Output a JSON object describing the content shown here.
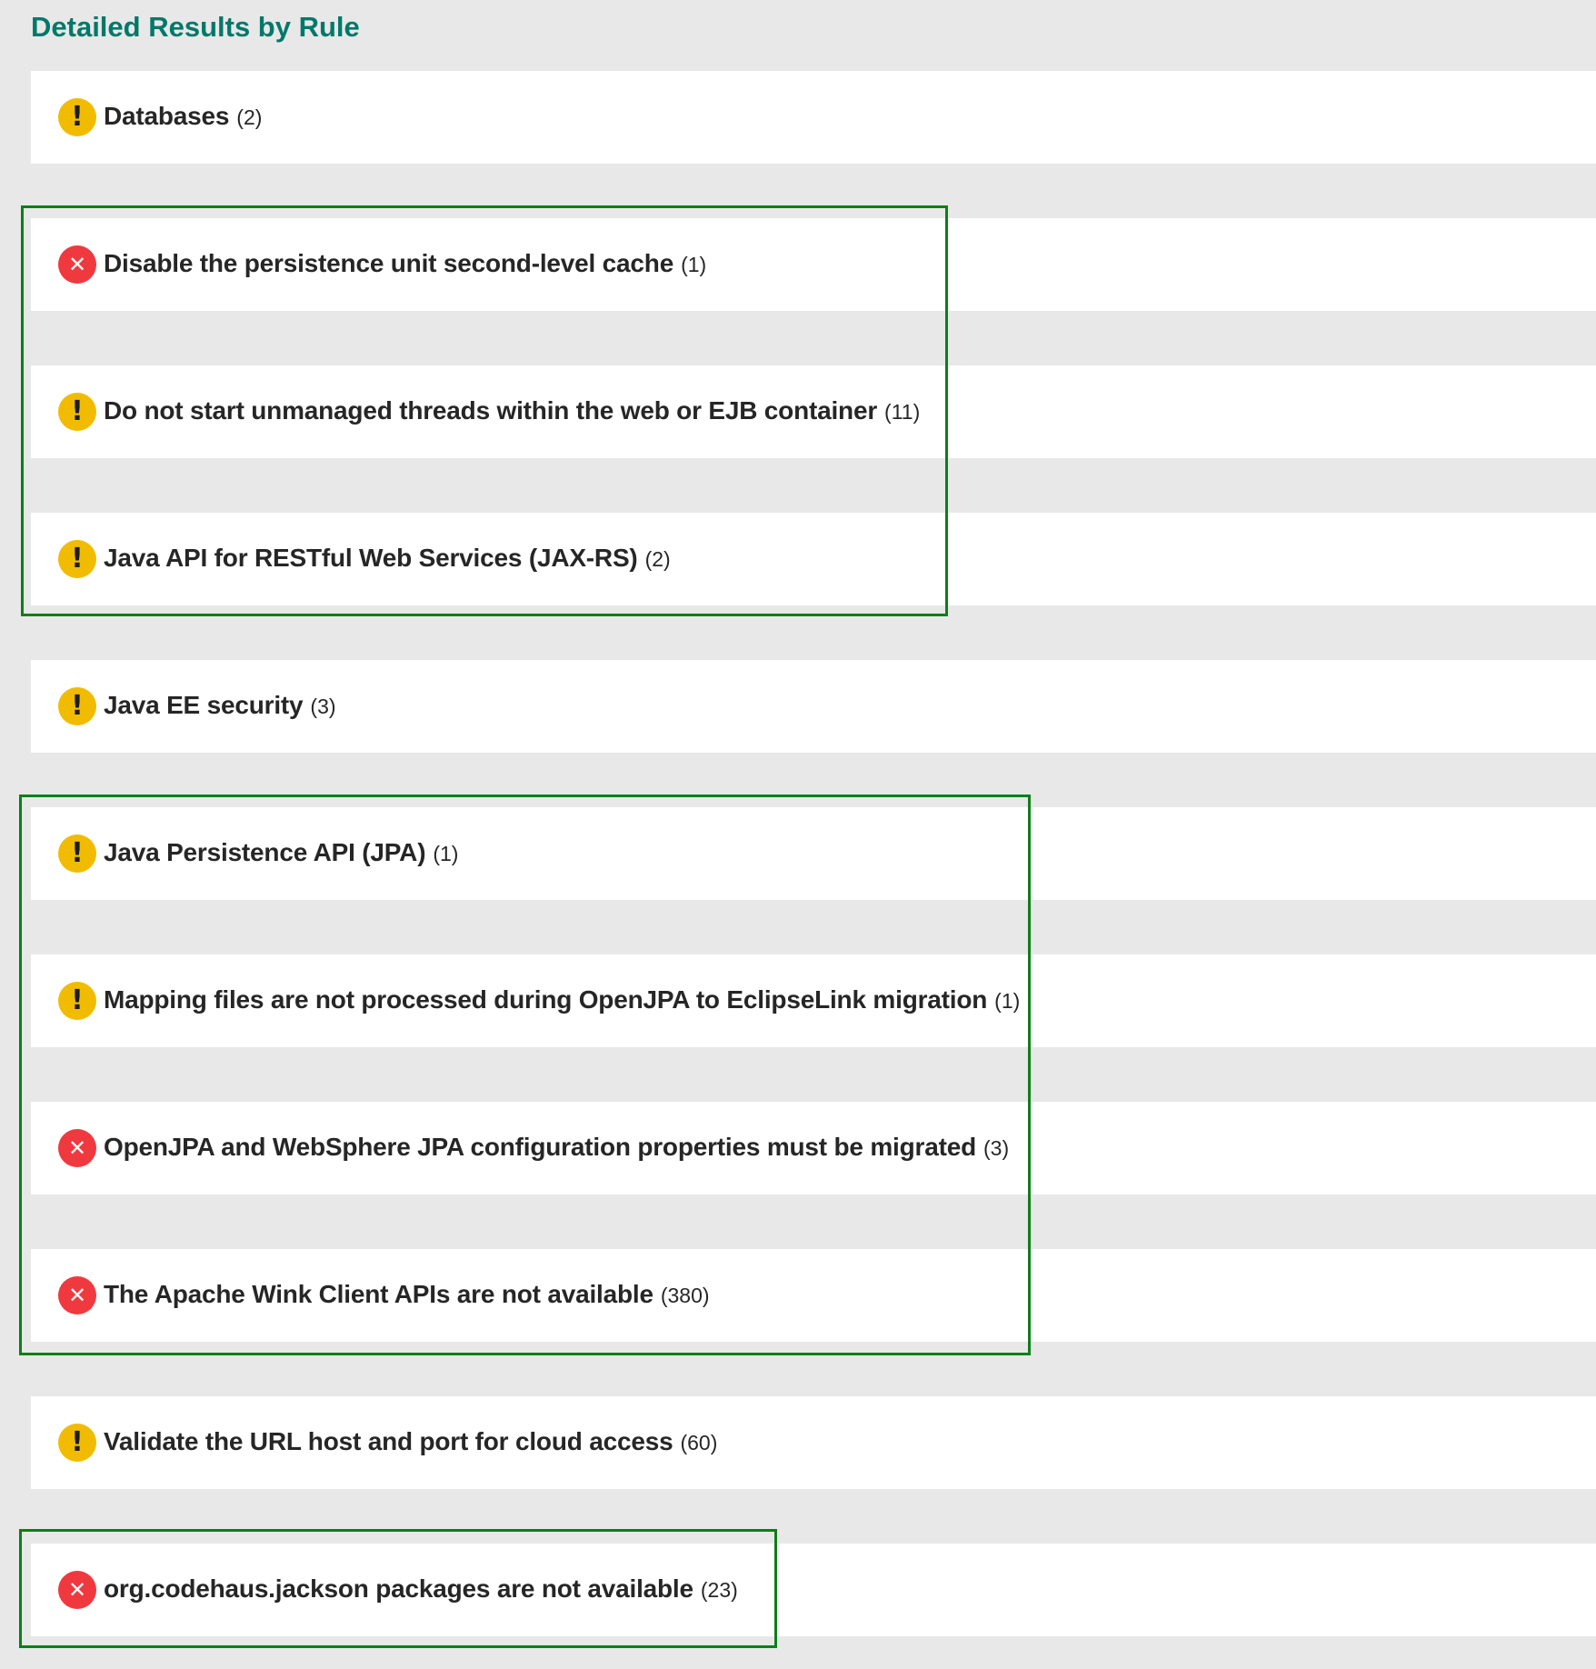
{
  "header": {
    "title": "Detailed Results by Rule"
  },
  "rules": [
    {
      "label": "Databases",
      "count": "(2)",
      "severity": "warning",
      "icon": "exclamation-icon",
      "icon_glyph": "!"
    },
    {
      "label": "Disable the persistence unit second-level cache",
      "count": "(1)",
      "severity": "error",
      "icon": "close-icon",
      "icon_glyph": "✕"
    },
    {
      "label": "Do not start unmanaged threads within the web or EJB container",
      "count": "(11)",
      "severity": "warning",
      "icon": "exclamation-icon",
      "icon_glyph": "!"
    },
    {
      "label": "Java API for RESTful Web Services (JAX-RS)",
      "count": "(2)",
      "severity": "warning",
      "icon": "exclamation-icon",
      "icon_glyph": "!"
    },
    {
      "label": "Java EE security",
      "count": "(3)",
      "severity": "warning",
      "icon": "exclamation-icon",
      "icon_glyph": "!"
    },
    {
      "label": "Java Persistence API (JPA)",
      "count": "(1)",
      "severity": "warning",
      "icon": "exclamation-icon",
      "icon_glyph": "!"
    },
    {
      "label": "Mapping files are not processed during OpenJPA to EclipseLink migration",
      "count": "(1)",
      "severity": "warning",
      "icon": "exclamation-icon",
      "icon_glyph": "!"
    },
    {
      "label": "OpenJPA and WebSphere JPA configuration properties must be migrated",
      "count": "(3)",
      "severity": "error",
      "icon": "close-icon",
      "icon_glyph": "✕"
    },
    {
      "label": "The Apache Wink Client APIs are not available",
      "count": "(380)",
      "severity": "error",
      "icon": "close-icon",
      "icon_glyph": "✕"
    },
    {
      "label": "Validate the URL host and port for cloud access",
      "count": "(60)",
      "severity": "warning",
      "icon": "exclamation-icon",
      "icon_glyph": "!"
    },
    {
      "label": "org.codehaus.jackson packages are not available",
      "count": "(23)",
      "severity": "error",
      "icon": "close-icon",
      "icon_glyph": "✕"
    }
  ],
  "colors": {
    "title": "#00786a",
    "warning": "#f1bc00",
    "error": "#f0393f",
    "highlight_border": "#0a8016",
    "background": "#e8e8e8",
    "row_background": "#ffffff"
  }
}
